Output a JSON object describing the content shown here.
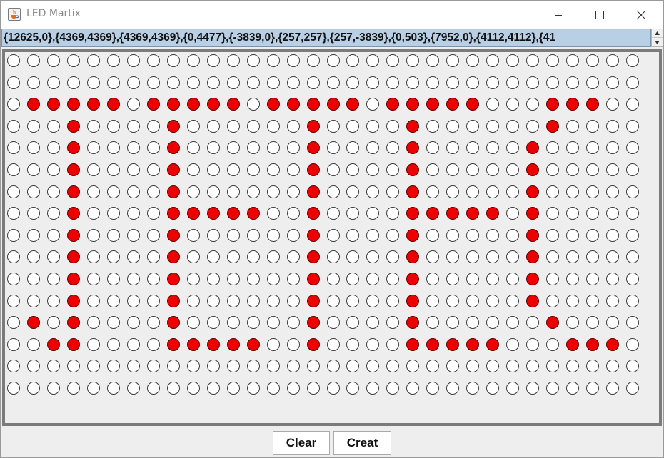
{
  "window": {
    "title": "LED Martix",
    "icon": "java-cup-icon"
  },
  "data_field": {
    "value": "{12625,0},{4369,4369},{4369,4369},{0,4477},{-3839,0},{257,257},{257,-3839},{0,503},{7952,0},{4112,4112},{41"
  },
  "matrix": {
    "cols": 32,
    "rows": 16,
    "on_color": "#ee0000",
    "off_color": "#ffffff",
    "rows_state": [
      "00000000000000000000000000000000",
      "00000000000000000000000000000000",
      "01111101111101111101111100011100",
      "00010000100000010000100000010000",
      "00010000100000010000100000100000",
      "00010000100000010000100000100000",
      "00010000100000010000100000100000",
      "00010000111110010000111110100000",
      "00010000100000010000100000100000",
      "00010000100000010000100000100000",
      "00010000100000010000100000100000",
      "00010000100000010000100000100000",
      "01010000100000010000100000010000",
      "00110000111110010000111110001110",
      "00000000000000000000000000000000",
      "00000000000000000000000000000000"
    ]
  },
  "buttons": {
    "clear": "Clear",
    "create": "Creat"
  }
}
